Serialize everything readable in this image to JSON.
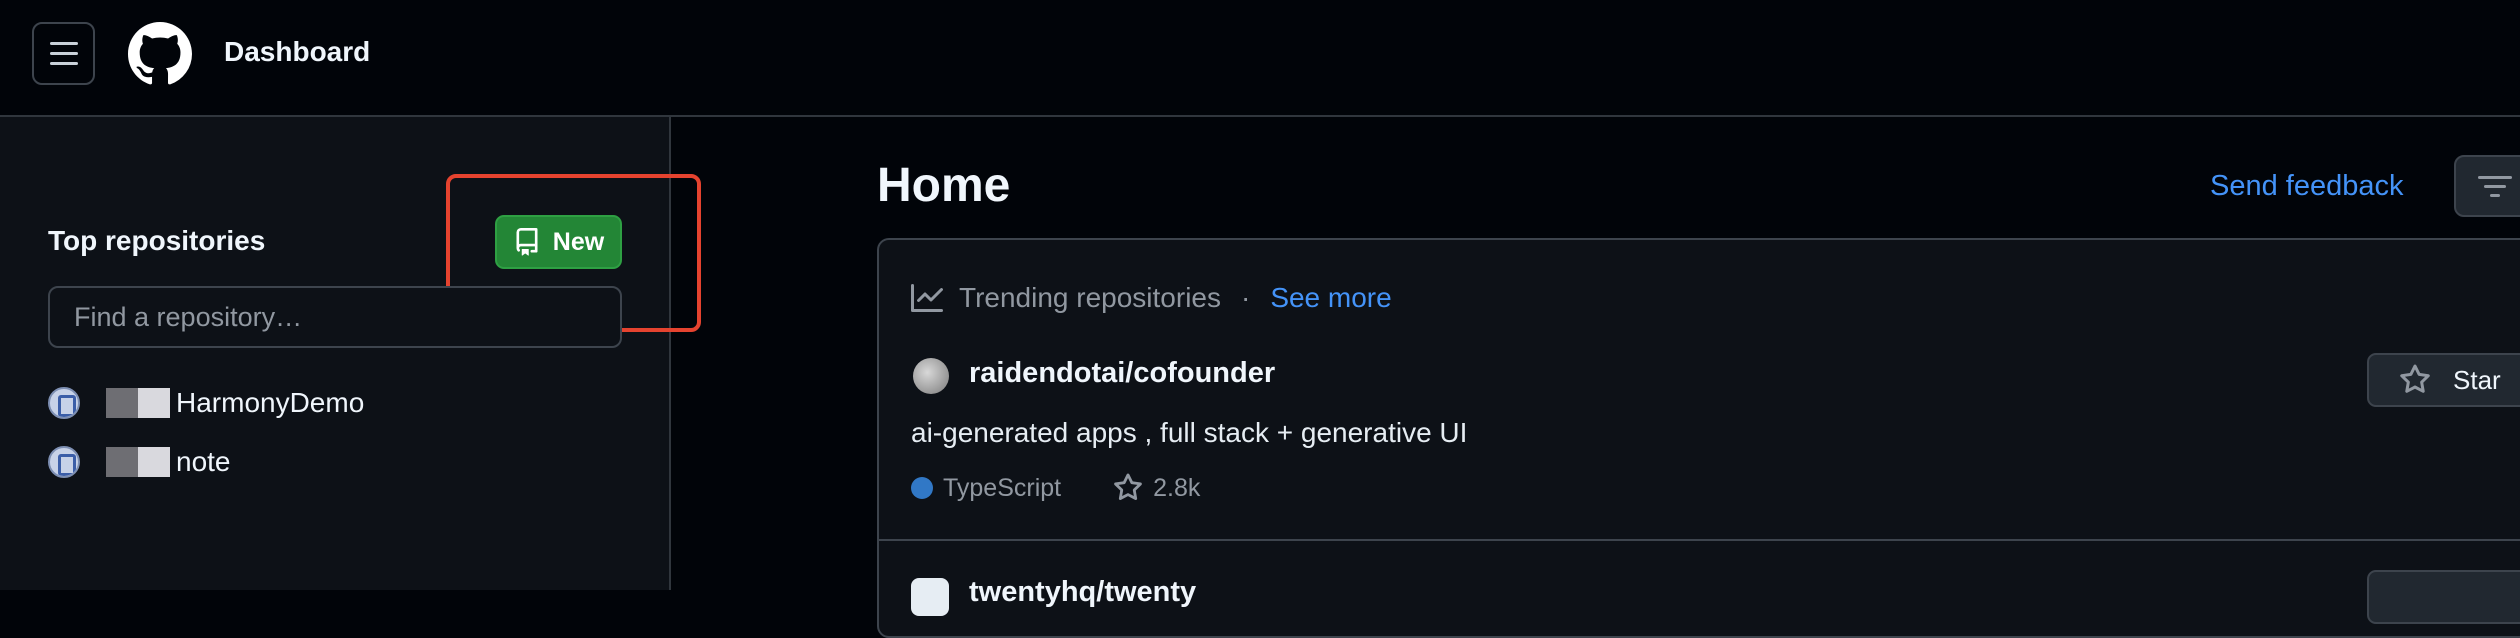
{
  "header": {
    "title": "Dashboard"
  },
  "sidebar": {
    "heading": "Top repositories",
    "new_button_label": "New",
    "search_placeholder": "Find a repository…",
    "repos": [
      {
        "name": "HarmonyDemo"
      },
      {
        "name": "note"
      }
    ]
  },
  "main": {
    "title": "Home",
    "feedback_label": "Send feedback",
    "card": {
      "header_label": "Trending repositories",
      "separator": "·",
      "see_more_label": "See more",
      "repo": {
        "name": "raidendotai/cofounder",
        "description": "ai-generated apps , full stack + generative UI",
        "language": "TypeScript",
        "language_color": "#3178c6",
        "stars": "2.8k",
        "star_button_label": "Star"
      },
      "repo2": {
        "name": "twentyhq/twenty"
      }
    }
  },
  "colors": {
    "background": "#010409",
    "panel": "#0d1117",
    "accent_green": "#238636",
    "link_blue": "#4493f8",
    "highlight_red": "#e5432f"
  }
}
